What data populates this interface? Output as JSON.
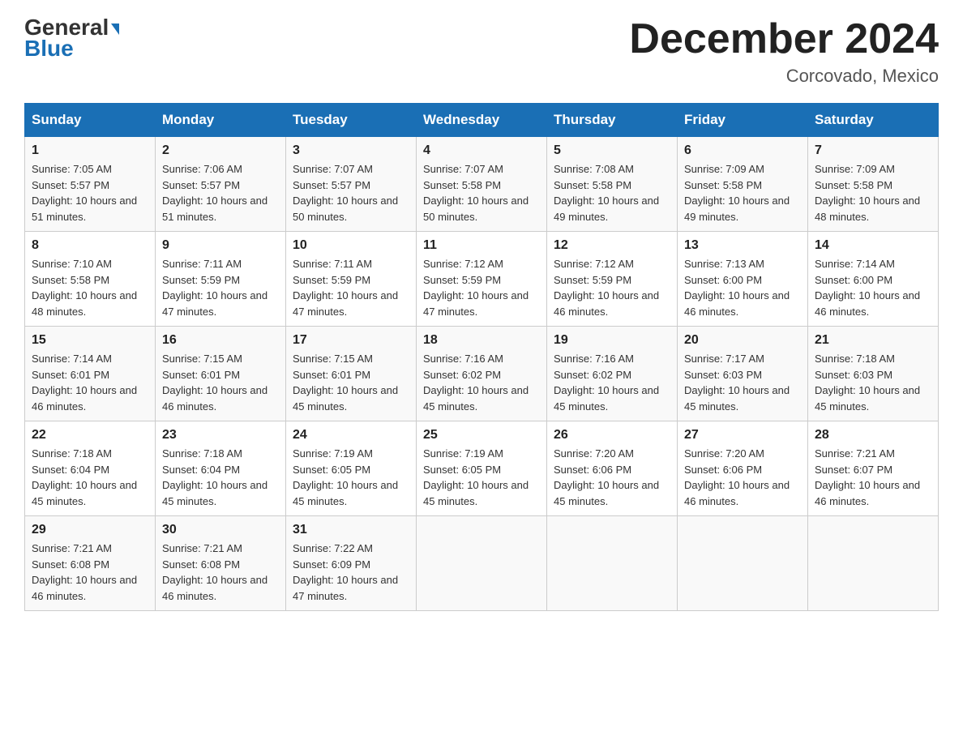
{
  "header": {
    "logo_general": "General",
    "logo_blue": "Blue",
    "month_year": "December 2024",
    "location": "Corcovado, Mexico"
  },
  "days_of_week": [
    "Sunday",
    "Monday",
    "Tuesday",
    "Wednesday",
    "Thursday",
    "Friday",
    "Saturday"
  ],
  "weeks": [
    [
      {
        "day": "1",
        "sunrise": "7:05 AM",
        "sunset": "5:57 PM",
        "daylight": "10 hours and 51 minutes."
      },
      {
        "day": "2",
        "sunrise": "7:06 AM",
        "sunset": "5:57 PM",
        "daylight": "10 hours and 51 minutes."
      },
      {
        "day": "3",
        "sunrise": "7:07 AM",
        "sunset": "5:57 PM",
        "daylight": "10 hours and 50 minutes."
      },
      {
        "day": "4",
        "sunrise": "7:07 AM",
        "sunset": "5:58 PM",
        "daylight": "10 hours and 50 minutes."
      },
      {
        "day": "5",
        "sunrise": "7:08 AM",
        "sunset": "5:58 PM",
        "daylight": "10 hours and 49 minutes."
      },
      {
        "day": "6",
        "sunrise": "7:09 AM",
        "sunset": "5:58 PM",
        "daylight": "10 hours and 49 minutes."
      },
      {
        "day": "7",
        "sunrise": "7:09 AM",
        "sunset": "5:58 PM",
        "daylight": "10 hours and 48 minutes."
      }
    ],
    [
      {
        "day": "8",
        "sunrise": "7:10 AM",
        "sunset": "5:58 PM",
        "daylight": "10 hours and 48 minutes."
      },
      {
        "day": "9",
        "sunrise": "7:11 AM",
        "sunset": "5:59 PM",
        "daylight": "10 hours and 47 minutes."
      },
      {
        "day": "10",
        "sunrise": "7:11 AM",
        "sunset": "5:59 PM",
        "daylight": "10 hours and 47 minutes."
      },
      {
        "day": "11",
        "sunrise": "7:12 AM",
        "sunset": "5:59 PM",
        "daylight": "10 hours and 47 minutes."
      },
      {
        "day": "12",
        "sunrise": "7:12 AM",
        "sunset": "5:59 PM",
        "daylight": "10 hours and 46 minutes."
      },
      {
        "day": "13",
        "sunrise": "7:13 AM",
        "sunset": "6:00 PM",
        "daylight": "10 hours and 46 minutes."
      },
      {
        "day": "14",
        "sunrise": "7:14 AM",
        "sunset": "6:00 PM",
        "daylight": "10 hours and 46 minutes."
      }
    ],
    [
      {
        "day": "15",
        "sunrise": "7:14 AM",
        "sunset": "6:01 PM",
        "daylight": "10 hours and 46 minutes."
      },
      {
        "day": "16",
        "sunrise": "7:15 AM",
        "sunset": "6:01 PM",
        "daylight": "10 hours and 46 minutes."
      },
      {
        "day": "17",
        "sunrise": "7:15 AM",
        "sunset": "6:01 PM",
        "daylight": "10 hours and 45 minutes."
      },
      {
        "day": "18",
        "sunrise": "7:16 AM",
        "sunset": "6:02 PM",
        "daylight": "10 hours and 45 minutes."
      },
      {
        "day": "19",
        "sunrise": "7:16 AM",
        "sunset": "6:02 PM",
        "daylight": "10 hours and 45 minutes."
      },
      {
        "day": "20",
        "sunrise": "7:17 AM",
        "sunset": "6:03 PM",
        "daylight": "10 hours and 45 minutes."
      },
      {
        "day": "21",
        "sunrise": "7:18 AM",
        "sunset": "6:03 PM",
        "daylight": "10 hours and 45 minutes."
      }
    ],
    [
      {
        "day": "22",
        "sunrise": "7:18 AM",
        "sunset": "6:04 PM",
        "daylight": "10 hours and 45 minutes."
      },
      {
        "day": "23",
        "sunrise": "7:18 AM",
        "sunset": "6:04 PM",
        "daylight": "10 hours and 45 minutes."
      },
      {
        "day": "24",
        "sunrise": "7:19 AM",
        "sunset": "6:05 PM",
        "daylight": "10 hours and 45 minutes."
      },
      {
        "day": "25",
        "sunrise": "7:19 AM",
        "sunset": "6:05 PM",
        "daylight": "10 hours and 45 minutes."
      },
      {
        "day": "26",
        "sunrise": "7:20 AM",
        "sunset": "6:06 PM",
        "daylight": "10 hours and 45 minutes."
      },
      {
        "day": "27",
        "sunrise": "7:20 AM",
        "sunset": "6:06 PM",
        "daylight": "10 hours and 46 minutes."
      },
      {
        "day": "28",
        "sunrise": "7:21 AM",
        "sunset": "6:07 PM",
        "daylight": "10 hours and 46 minutes."
      }
    ],
    [
      {
        "day": "29",
        "sunrise": "7:21 AM",
        "sunset": "6:08 PM",
        "daylight": "10 hours and 46 minutes."
      },
      {
        "day": "30",
        "sunrise": "7:21 AM",
        "sunset": "6:08 PM",
        "daylight": "10 hours and 46 minutes."
      },
      {
        "day": "31",
        "sunrise": "7:22 AM",
        "sunset": "6:09 PM",
        "daylight": "10 hours and 47 minutes."
      },
      null,
      null,
      null,
      null
    ]
  ],
  "labels": {
    "sunrise": "Sunrise: ",
    "sunset": "Sunset: ",
    "daylight": "Daylight: "
  }
}
